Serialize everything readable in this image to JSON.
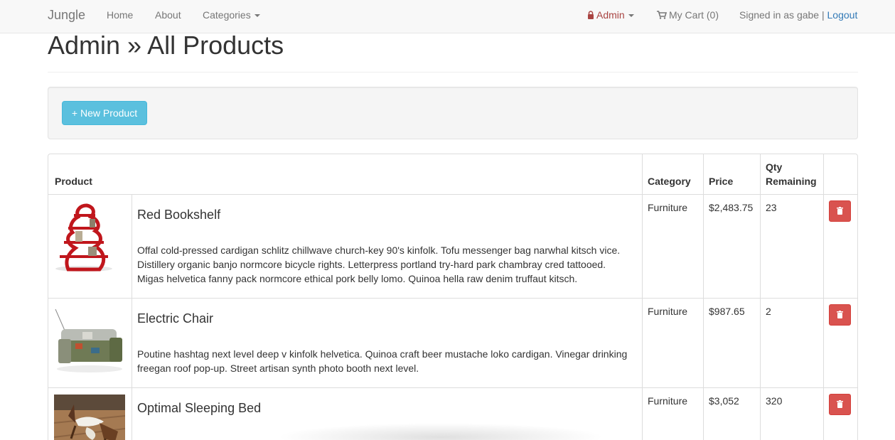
{
  "nav": {
    "brand": "Jungle",
    "home": "Home",
    "about": "About",
    "categories": "Categories",
    "admin": "Admin",
    "cart": "My Cart (0)",
    "signed_in": "Signed in as gabe",
    "separator": "|",
    "logout": "Logout"
  },
  "page": {
    "title": "Admin » All Products",
    "new_product_label": "+ New Product"
  },
  "table": {
    "headers": {
      "product": "Product",
      "category": "Category",
      "price": "Price",
      "qty_line1": "Qty",
      "qty_line2": "Remaining"
    },
    "rows": [
      {
        "name": "Red Bookshelf",
        "description_lines": [
          "Offal cold-pressed cardigan schlitz chillwave church-key 90's kinfolk. Tofu messenger bag narwhal kitsch vice.",
          "Distillery organic banjo normcore bicycle rights. Letterpress portland try-hard park chambray cred tattooed.",
          "Migas helvetica fanny pack normcore ethical pork belly lomo. Quinoa hella raw denim truffaut kitsch."
        ],
        "category": "Furniture",
        "price": "$2,483.75",
        "qty": "23"
      },
      {
        "name": "Electric Chair",
        "description_lines": [
          "Poutine hashtag next level deep v kinfolk helvetica. Quinoa craft beer mustache loko cardigan. Vinegar drinking",
          "freegan roof pop-up. Street artisan synth photo booth next level."
        ],
        "category": "Furniture",
        "price": "$987.65",
        "qty": "2"
      },
      {
        "name": "Optimal Sleeping Bed",
        "description_lines": [],
        "category": "Furniture",
        "price": "$3,052",
        "qty": "320"
      }
    ]
  },
  "colors": {
    "navbar_bg": "#f8f8f8",
    "info_button": "#5bc0de",
    "danger_button": "#d9534f",
    "admin_red": "#a94442",
    "link_blue": "#337ab7"
  },
  "icons": {
    "lock": "lock-icon",
    "cart": "cart-icon",
    "trash": "trash-icon"
  }
}
